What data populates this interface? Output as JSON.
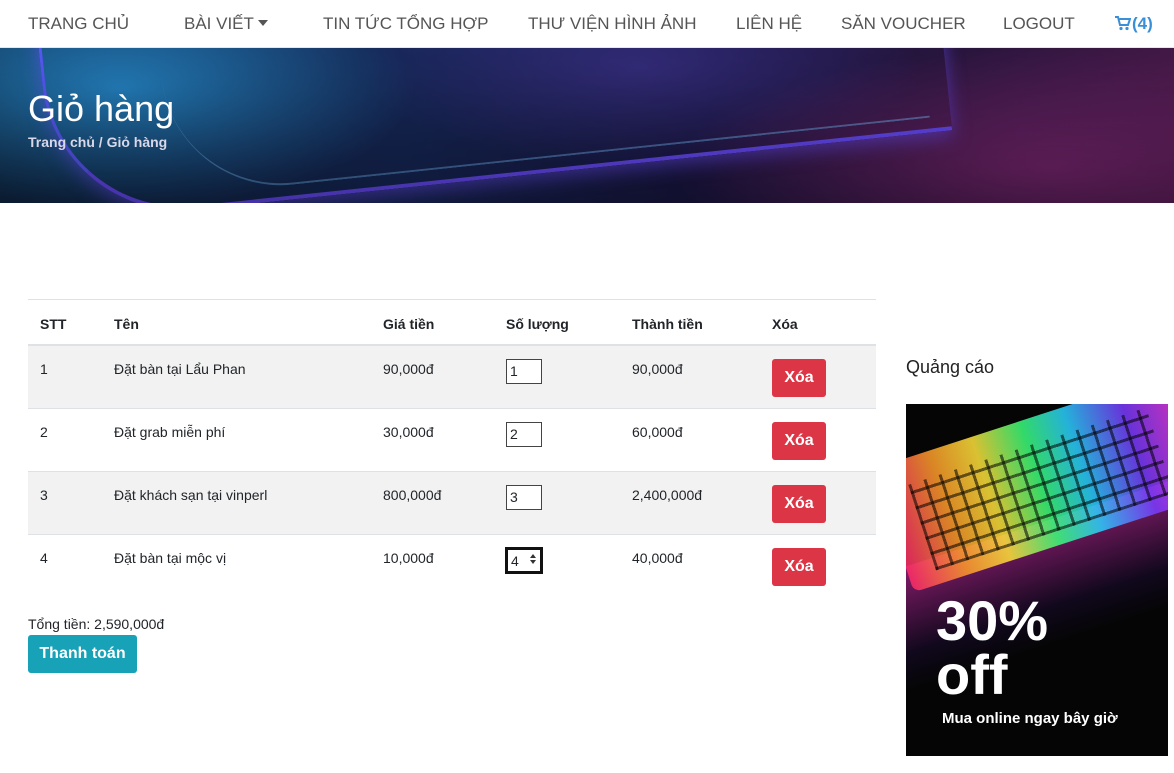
{
  "nav": {
    "home": "TRANG CHỦ",
    "posts": "BÀI VIẾT",
    "news": "TIN TỨC TỔNG HỢP",
    "gallery": "THƯ VIỆN HÌNH ẢNH",
    "contact": "LIÊN HỆ",
    "voucher": "SĂN VOUCHER",
    "logout": "LOGOUT",
    "cart_count": "(4)"
  },
  "hero": {
    "title": "Giỏ hàng",
    "breadcrumb": "Trang chủ / Giỏ hàng"
  },
  "table": {
    "headers": [
      "STT",
      "Tên",
      "Giá tiền",
      "Số lượng",
      "Thành tiền",
      "Xóa"
    ],
    "rows": [
      {
        "stt": "1",
        "name": "Đặt bàn tại Lẩu Phan",
        "price": "90,000đ",
        "qty": "1",
        "subtotal": "90,000đ",
        "delete_label": "Xóa"
      },
      {
        "stt": "2",
        "name": "Đặt grab miễn phí",
        "price": "30,000đ",
        "qty": "2",
        "subtotal": "60,000đ",
        "delete_label": "Xóa"
      },
      {
        "stt": "3",
        "name": "Đặt khách sạn tại vinperl",
        "price": "800,000đ",
        "qty": "3",
        "subtotal": "2,400,000đ",
        "delete_label": "Xóa"
      },
      {
        "stt": "4",
        "name": "Đặt bàn tại mộc vị",
        "price": "10,000đ",
        "qty": "4",
        "subtotal": "40,000đ",
        "delete_label": "Xóa"
      }
    ]
  },
  "summary": {
    "total": "Tổng tiền: 2,590,000đ",
    "checkout_label": "Thanh toán"
  },
  "sidebar": {
    "ad_title": "Quảng cáo",
    "ad_percent": "30%",
    "ad_off": "off",
    "ad_cta": "Mua online ngay bây giờ"
  },
  "colors": {
    "delete": "#dc3545",
    "checkout": "#17a2b8",
    "cart_link": "#3a8fd9"
  },
  "icons": [
    "cart-icon",
    "caret-down-icon"
  ]
}
